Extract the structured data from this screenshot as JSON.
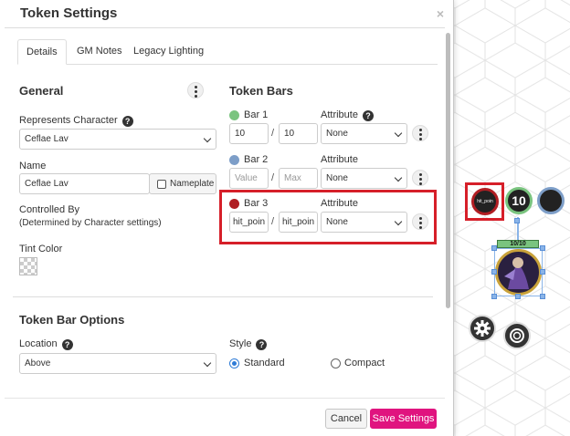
{
  "dialog": {
    "title": "Token Settings",
    "close": "×",
    "tabs": [
      "Details",
      "GM Notes",
      "Legacy Lighting"
    ]
  },
  "general": {
    "heading": "General",
    "represents_label": "Represents Character",
    "represents_value": "Ceflae Lav",
    "name_label": "Name",
    "name_value": "Ceflae Lav",
    "nameplate_label": "Nameplate",
    "controlled_by_label": "Controlled By",
    "controlled_by_note": "(Determined by Character settings)",
    "tint_label": "Tint Color"
  },
  "token_bars": {
    "heading": "Token Bars",
    "attribute_label": "Attribute",
    "bars": [
      {
        "name": "Bar 1",
        "color": "#7ac47f",
        "value": "10",
        "value_placeholder": "",
        "max": "10",
        "max_placeholder": "",
        "attribute": "None"
      },
      {
        "name": "Bar 2",
        "color": "#7d9ec8",
        "value": "",
        "value_placeholder": "Value",
        "max": "",
        "max_placeholder": "Max",
        "attribute": "None"
      },
      {
        "name": "Bar 3",
        "color": "#b01e23",
        "value": "hit_poin",
        "value_placeholder": "",
        "max": "hit_poin",
        "max_placeholder": "",
        "attribute": "None"
      }
    ],
    "slash": "/"
  },
  "bar_options": {
    "heading": "Token Bar Options",
    "location_label": "Location",
    "location_value": "Above",
    "style_label": "Style",
    "style_options": [
      "Standard",
      "Compact"
    ],
    "style_selected": "Standard"
  },
  "footer": {
    "cancel_label": "Cancel",
    "save_label": "Save Settings"
  },
  "canvas": {
    "bar_value_badge": "10",
    "bar_label": "10/10",
    "mini_label": "hit_poin"
  },
  "colors": {
    "accent": "#e0147f",
    "highlight": "#d61f29",
    "selection": "#8ab4e8",
    "bar1": "#7ac47f",
    "bar2": "#7d9ec8",
    "bar3": "#b01e23"
  }
}
